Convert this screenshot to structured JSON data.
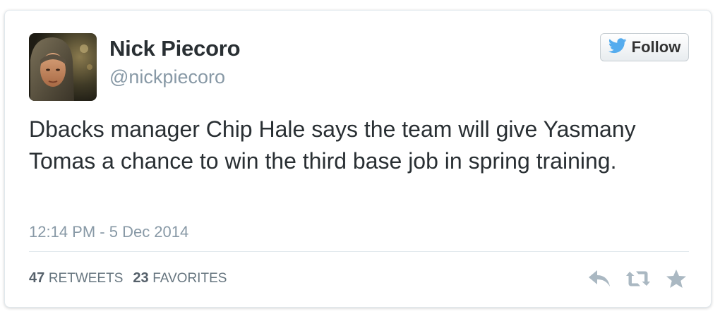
{
  "author": {
    "name": "Nick Piecoro",
    "handle": "@nickpiecoro",
    "avatar_icon": "profile-photo"
  },
  "follow_button": {
    "label": "Follow",
    "icon": "twitter-bird-icon",
    "icon_color": "#55acee"
  },
  "tweet": {
    "text": "Dbacks manager Chip Hale says the team will give Yasmany Tomas a chance to win the third base job in spring training.",
    "timestamp": "12:14 PM - 5 Dec 2014"
  },
  "stats": {
    "retweets": {
      "count": "47",
      "label": "RETWEETS"
    },
    "favorites": {
      "count": "23",
      "label": "FAVORITES"
    }
  },
  "actions": {
    "reply_icon": "reply-icon",
    "retweet_icon": "retweet-icon",
    "favorite_icon": "star-icon",
    "icon_color": "#aab8c2"
  }
}
